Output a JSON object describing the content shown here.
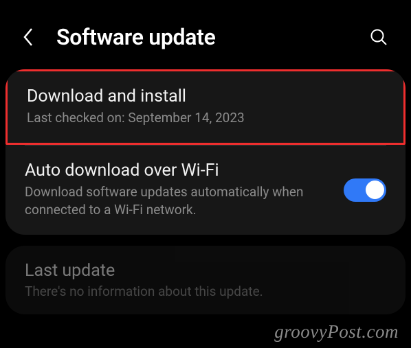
{
  "header": {
    "title": "Software update"
  },
  "items": {
    "download": {
      "title": "Download and install",
      "subtitle": "Last checked on: September 14, 2023"
    },
    "autoDownload": {
      "title": "Auto download over Wi-Fi",
      "subtitle": "Download software updates automatically when connected to a Wi-Fi network.",
      "toggleOn": true
    },
    "lastUpdate": {
      "title": "Last update",
      "subtitle": "There's no information about this update."
    }
  },
  "watermark": "groovyPost.com"
}
